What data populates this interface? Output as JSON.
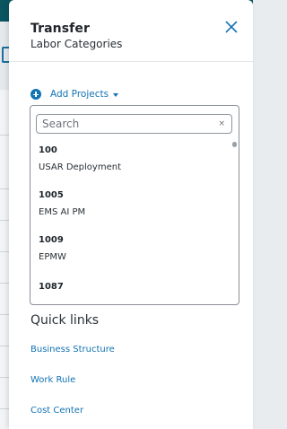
{
  "panel": {
    "title": "Transfer",
    "subtitle": "Labor Categories",
    "close_icon": "close-icon"
  },
  "add_projects": {
    "label": "Add Projects",
    "icon": "add-circle-icon",
    "caret": "caret-down-icon"
  },
  "search": {
    "placeholder": "Search",
    "value": "",
    "clear_glyph": "×"
  },
  "projects": [
    {
      "code": "100",
      "name": "USAR Deployment"
    },
    {
      "code": "1005",
      "name": "EMS AI PM"
    },
    {
      "code": "1009",
      "name": "EPMW"
    },
    {
      "code": "1087",
      "name": ""
    }
  ],
  "quick_links": {
    "title": "Quick links",
    "items": [
      {
        "label": "Business Structure"
      },
      {
        "label": "Work Rule"
      },
      {
        "label": "Cost Center"
      }
    ]
  },
  "colors": {
    "accent": "#1173b4",
    "header_bar": "#0b5560",
    "text": "#2a3036"
  }
}
